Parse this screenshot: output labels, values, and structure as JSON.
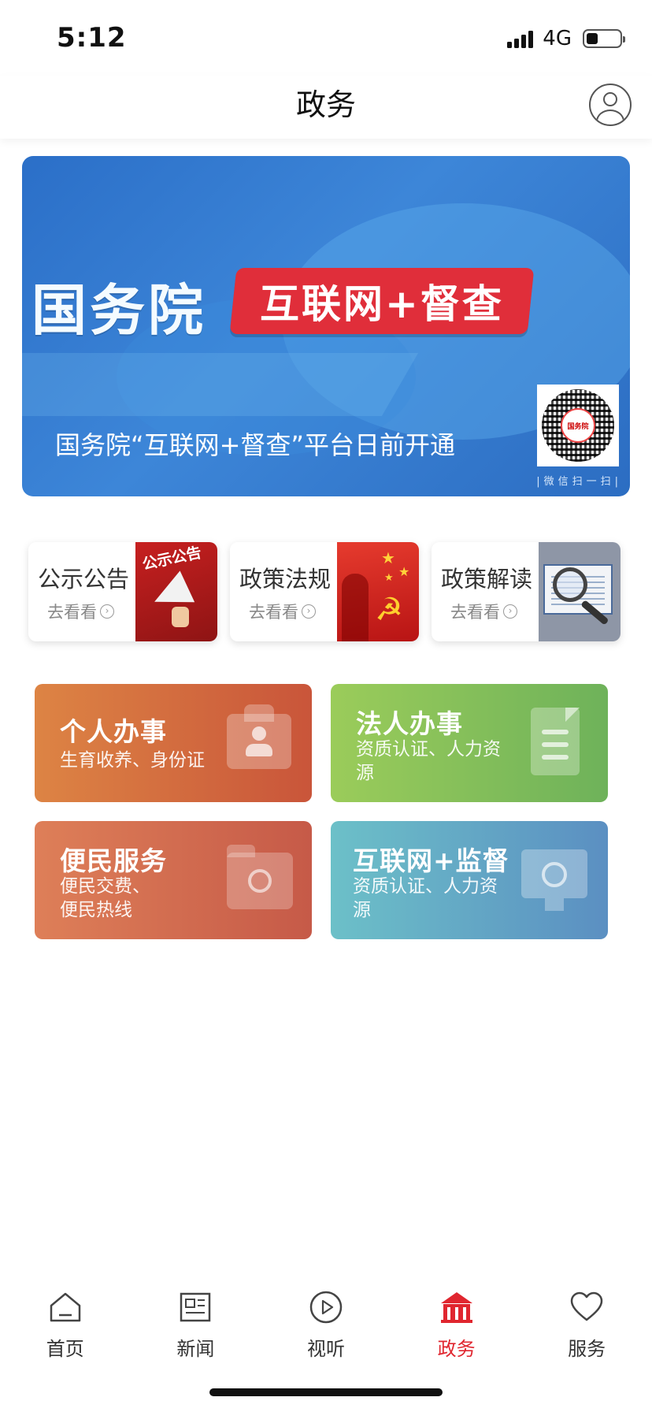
{
  "status_bar": {
    "time": "5:12",
    "network": "4G",
    "battery_level": 0.35
  },
  "header": {
    "title": "政务"
  },
  "banner": {
    "org": "国务院",
    "tag": "互联网+督查",
    "caption": "国务院“互联网+督查”平台日前开通",
    "qr_center": "国务院",
    "qr_caption": "|微信扫一扫|"
  },
  "quick_links": [
    {
      "title": "公示公告",
      "sub": "去看看",
      "image_tag": "公示公告"
    },
    {
      "title": "政策法规",
      "sub": "去看看"
    },
    {
      "title": "政策解读",
      "sub": "去看看"
    }
  ],
  "services": [
    {
      "title": "个人办事",
      "desc": "生育收养、身份证",
      "icon": "id-card-icon"
    },
    {
      "title": "法人办事",
      "desc": "资质认证、人力资源",
      "icon": "document-icon"
    },
    {
      "title": "便民服务",
      "desc": "便民交费、便民热线",
      "icon": "folder-compass-icon"
    },
    {
      "title": "互联网+监督",
      "desc": "资质认证、人力资源",
      "icon": "monitor-icon"
    }
  ],
  "tabbar": [
    {
      "label": "首页",
      "icon": "home-icon"
    },
    {
      "label": "新闻",
      "icon": "news-icon"
    },
    {
      "label": "视听",
      "icon": "play-icon"
    },
    {
      "label": "政务",
      "icon": "government-icon",
      "active": true
    },
    {
      "label": "服务",
      "icon": "heart-icon"
    }
  ],
  "colors": {
    "accent": "#e0262f",
    "banner_blue": "#2f74c8"
  }
}
